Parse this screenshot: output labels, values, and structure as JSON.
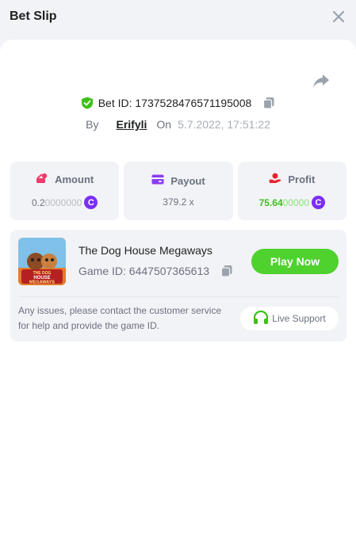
{
  "header": {
    "title": "Bet Slip"
  },
  "bet": {
    "id_text": "Bet ID: 1737528476571195008",
    "by_label": "By",
    "username": "Erifyli",
    "on_label": "On",
    "date": "5.7.2022, 17:51:22"
  },
  "stats": {
    "amount": {
      "label": "Amount",
      "value_main": "0.2",
      "value_dim": "0000000",
      "icon": "amount-icon"
    },
    "payout": {
      "label": "Payout",
      "value": "379.2 x",
      "icon": "payout-icon"
    },
    "profit": {
      "label": "Profit",
      "value_main": "75.64",
      "value_dim": "00000",
      "icon": "profit-icon"
    }
  },
  "coin_symbol": "C",
  "game": {
    "name": "The Dog House Megaways",
    "id_text": "Game ID: 6447507365613",
    "play_label": "Play Now",
    "thumb_text_1": "THE DOG",
    "thumb_text_2": "HOUSE",
    "thumb_text_3": "MEGAWAYS"
  },
  "support": {
    "issue_text": "Any issues, please contact the customer service for help and provide the game ID.",
    "button_label": "Live Support"
  },
  "colors": {
    "accent_green": "#4fd12e",
    "coin_purple": "#7b2ff7",
    "profit_green": "#3bc117"
  }
}
